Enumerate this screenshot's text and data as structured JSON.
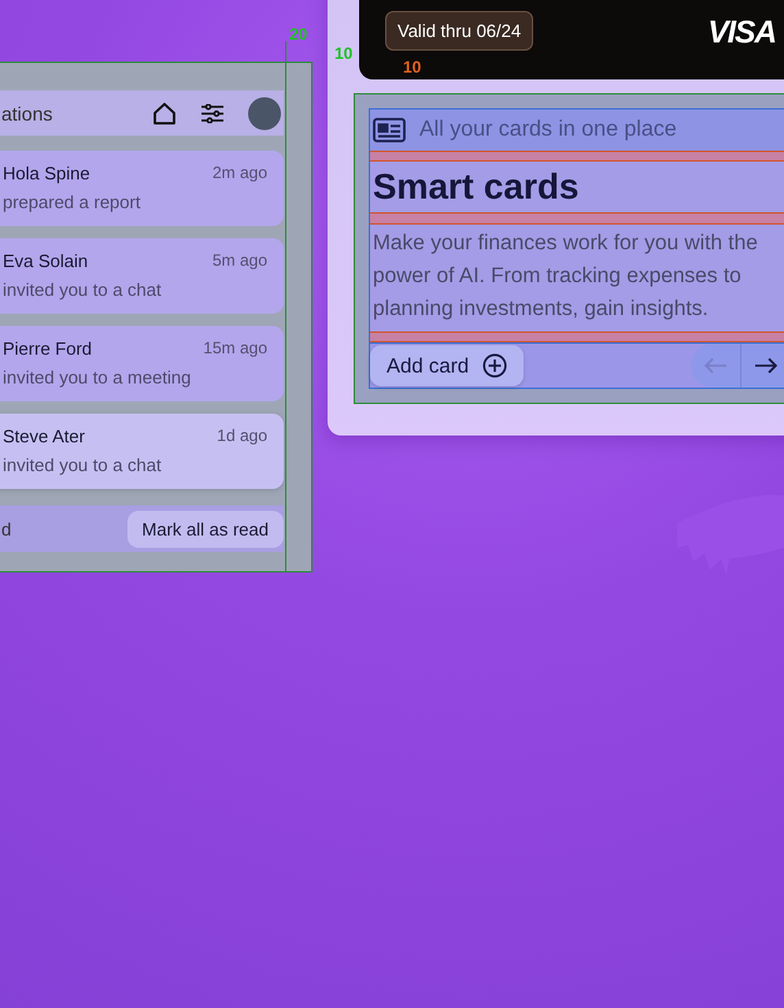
{
  "guides": [
    {
      "label": "20",
      "kind": "gap"
    },
    {
      "label": "10",
      "kind": "gap"
    },
    {
      "label": "10",
      "kind": "inner"
    }
  ],
  "notifications": {
    "title": "ations",
    "items": [
      {
        "name": "Hola Spine",
        "action": "prepared a report",
        "time": "2m ago",
        "selected": false
      },
      {
        "name": "Eva Solain",
        "action": "invited you to a chat",
        "time": "5m ago",
        "selected": false
      },
      {
        "name": "Pierre Ford",
        "action": "invited you to a meeting",
        "time": "15m ago",
        "selected": false
      },
      {
        "name": "Steve Ater",
        "action": "invited you to a chat",
        "time": "1d ago",
        "selected": true
      }
    ],
    "footer_text": "d",
    "mark_button": "Mark all as read"
  },
  "card": {
    "validity": "Valid thru 06/24",
    "brand": "VISA"
  },
  "smart_cards": {
    "tagline": "All your cards in one place",
    "title": "Smart cards",
    "body": "Make your finances work for you with the power of AI. From tracking expenses to planning investments, gain insights.",
    "add_button": "Add card"
  }
}
